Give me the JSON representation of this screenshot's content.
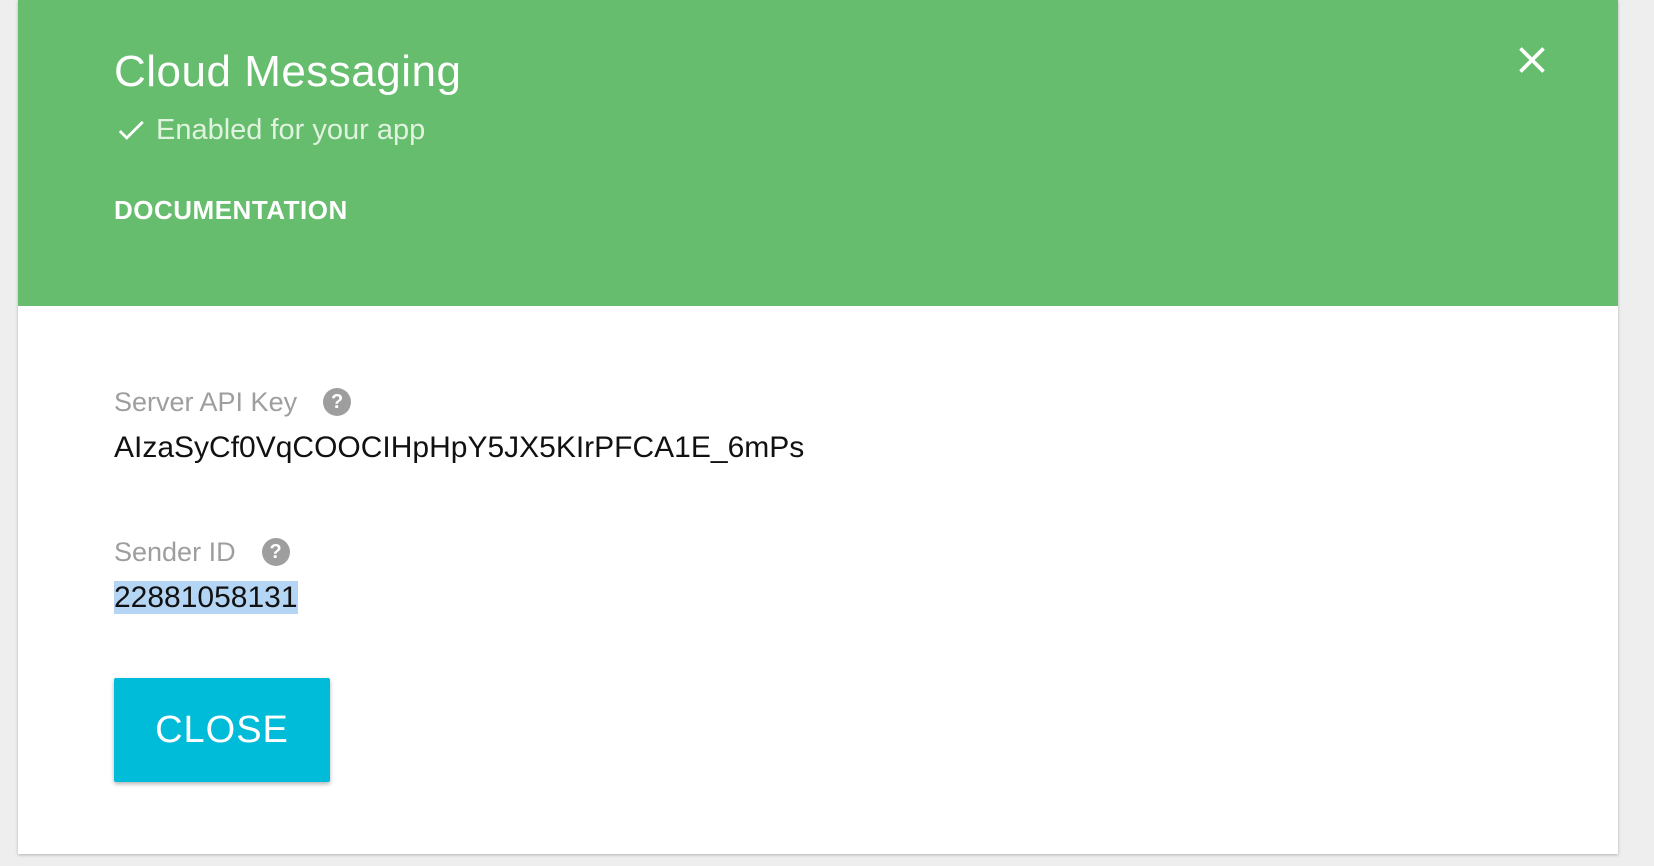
{
  "dialog": {
    "title": "Cloud Messaging",
    "status": "Enabled for your app",
    "documentation_label": "DOCUMENTATION",
    "header_color": "#66bd6d",
    "close_icon": "close-icon"
  },
  "fields": {
    "server_api_key": {
      "label": "Server API Key",
      "help_icon": "?",
      "value": "AIzaSyCf0VqCOOCIHpHpY5JX5KIrPFCA1E_6mPs"
    },
    "sender_id": {
      "label": "Sender ID",
      "help_icon": "?",
      "value": "22881058131"
    }
  },
  "actions": {
    "close_label": "CLOSE",
    "close_color": "#00bcd8"
  }
}
